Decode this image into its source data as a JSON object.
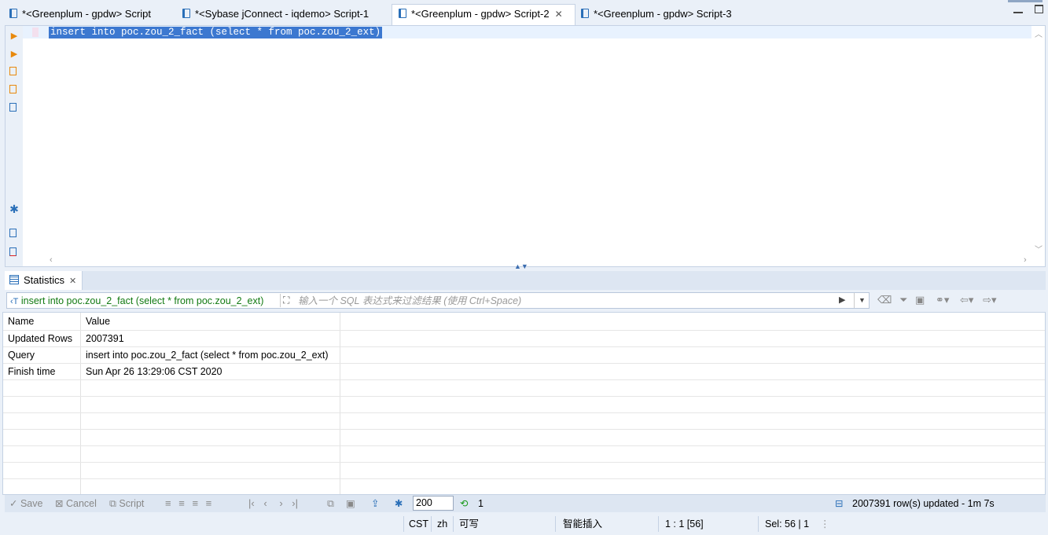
{
  "tabs": [
    {
      "label": "*<Greenplum - gpdw> Script"
    },
    {
      "label": "*<Sybase jConnect - iqdemo> Script-1"
    },
    {
      "label": "*<Greenplum - gpdw> Script-2"
    },
    {
      "label": "*<Greenplum - gpdw> Script-3"
    }
  ],
  "editor": {
    "sql": "insert into poc.zou_2_fact (select * from poc.zou_2_ext)"
  },
  "results": {
    "tab_label": "Statistics",
    "query_label": "insert into poc.zou_2_fact (select * from poc.zou_2_ext)",
    "filter_placeholder": "输入一个 SQL 表达式来过滤结果 (使用 Ctrl+Space)",
    "columns": [
      "Name",
      "Value"
    ],
    "rows": [
      {
        "name": "Updated Rows",
        "value": "2007391"
      },
      {
        "name": "Query",
        "value": "insert into poc.zou_2_fact (select * from poc.zou_2_ext)"
      },
      {
        "name": "Finish time",
        "value": "Sun Apr 26 13:29:06 CST 2020"
      }
    ]
  },
  "toolbar": {
    "save": "Save",
    "cancel": "Cancel",
    "script": "Script",
    "fetch_size": "200",
    "refresh_count": "1",
    "rows_info": "2007391 row(s) updated - 1m 7s"
  },
  "statusbar": {
    "timezone": "CST",
    "locale": "zh",
    "mode": "可写",
    "insert_mode": "智能插入",
    "position": "1 : 1 [56]",
    "selection": "Sel: 56 | 1"
  },
  "colors": {
    "selection": "#3c78d0",
    "query_text": "#127a12",
    "accent": "#2a6fb8"
  }
}
